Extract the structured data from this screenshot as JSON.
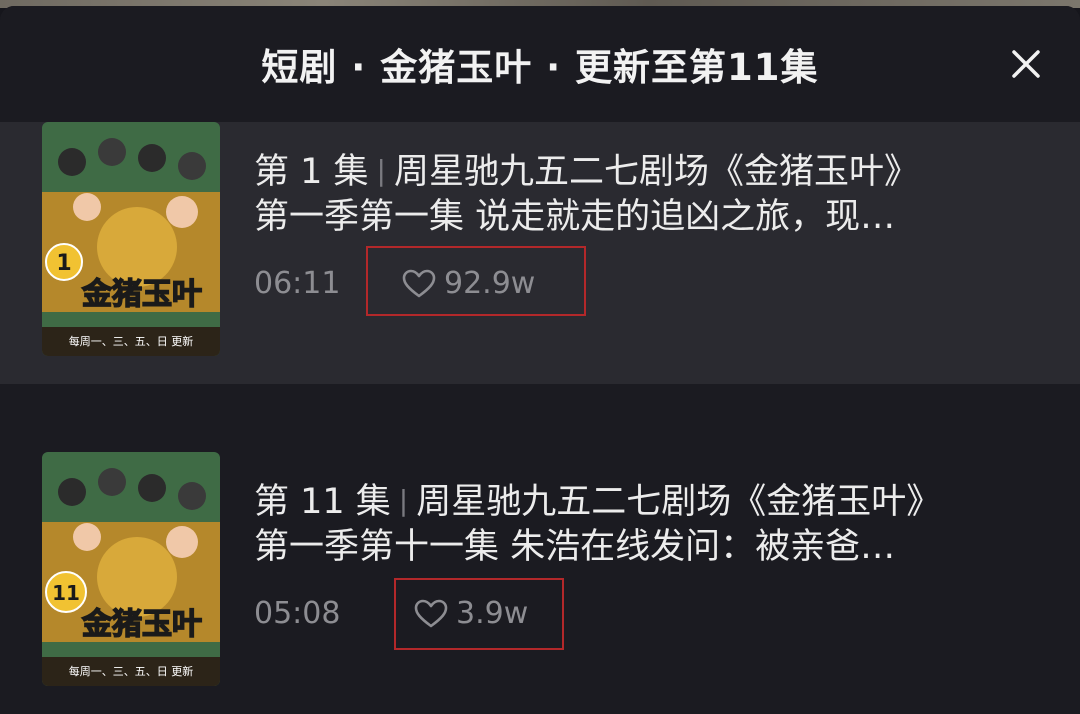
{
  "header": {
    "title": "短剧 · 金猪玉叶 · 更新至第11集",
    "close_icon": "close-icon"
  },
  "episodes": [
    {
      "ep_label": "第 1 集",
      "title_rest": "周星驰九五二七剧场《金猪玉叶》",
      "title_line2": "第一季第一集 说走就走的追凶之旅，现…",
      "duration": "06:11",
      "likes": "92.9w",
      "thumb_badge": "1",
      "thumb_title": "金猪玉叶",
      "thumb_bottom": "每周一、三、五、日 更新"
    },
    {
      "ep_label": "第 11 集",
      "title_rest": "周星驰九五二七剧场《金猪玉叶》",
      "title_line2": "第一季第十一集 朱浩在线发问：被亲爸…",
      "duration": "05:08",
      "likes": "3.9w",
      "thumb_badge": "11",
      "thumb_title": "金猪玉叶",
      "thumb_bottom": "每周一、三、五、日 更新"
    }
  ],
  "colors": {
    "background": "#1b1b21",
    "selected_row": "#2a2a30",
    "highlight_box": "#b3282a",
    "poster_green": "#3f6b45",
    "poster_gold": "#d8a93a"
  }
}
